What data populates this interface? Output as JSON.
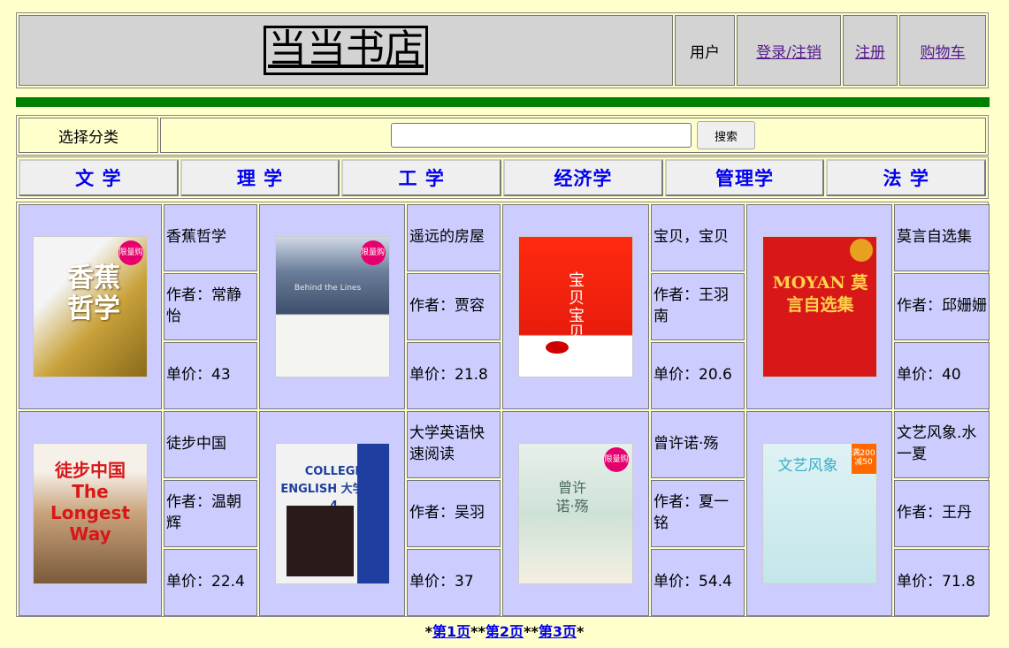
{
  "header": {
    "logo": "当当书店",
    "user_label": "用户",
    "login_link": "登录/注销",
    "register_link": "注册",
    "cart_link": "购物车"
  },
  "search": {
    "category_label": "选择分类",
    "input_value": "",
    "button_label": "搜索"
  },
  "categories": [
    "文 学",
    "理 学",
    "工 学",
    "经济学",
    "管理学",
    "法 学"
  ],
  "books": [
    {
      "title": "香蕉哲学",
      "author": "作者：常静怡",
      "price": "单价：43",
      "cover_text": "香蕉哲学",
      "badge": "限量购"
    },
    {
      "title": "遥远的房屋",
      "author": "作者：贾容",
      "price": "单价：21.8",
      "cover_text": "Behind the Lines",
      "badge": "限量购"
    },
    {
      "title": "宝贝，宝贝",
      "author": "作者：王羽南",
      "price": "单价：20.6",
      "cover_text": "宝贝宝贝",
      "badge": ""
    },
    {
      "title": "莫言自选集",
      "author": "作者：邱姗姗",
      "price": "单价：40",
      "cover_text": "MOYAN 莫言自选集",
      "badge": ""
    },
    {
      "title": "徒步中国",
      "author": "作者：温朝辉",
      "price": "单价：22.4",
      "cover_text": "徒步中国 The Longest Way",
      "badge": ""
    },
    {
      "title": "大学英语快速阅读",
      "author": "作者：吴羽",
      "price": "单价：37",
      "cover_text": "COLLEGE ENGLISH 大学英语 4",
      "badge": ""
    },
    {
      "title": "曾许诺·殇",
      "author": "作者：夏一铭",
      "price": "单价：54.4",
      "cover_text": "曾许诺·殇",
      "badge": "限量购"
    },
    {
      "title": "文艺风象.水一夏",
      "author": "作者：王丹",
      "price": "单价：71.8",
      "cover_text": "文艺风象",
      "badge": "满200减50"
    }
  ],
  "pager": {
    "sep": "*",
    "page1": "第1页",
    "page2": "第2页",
    "page3": "第3页"
  }
}
